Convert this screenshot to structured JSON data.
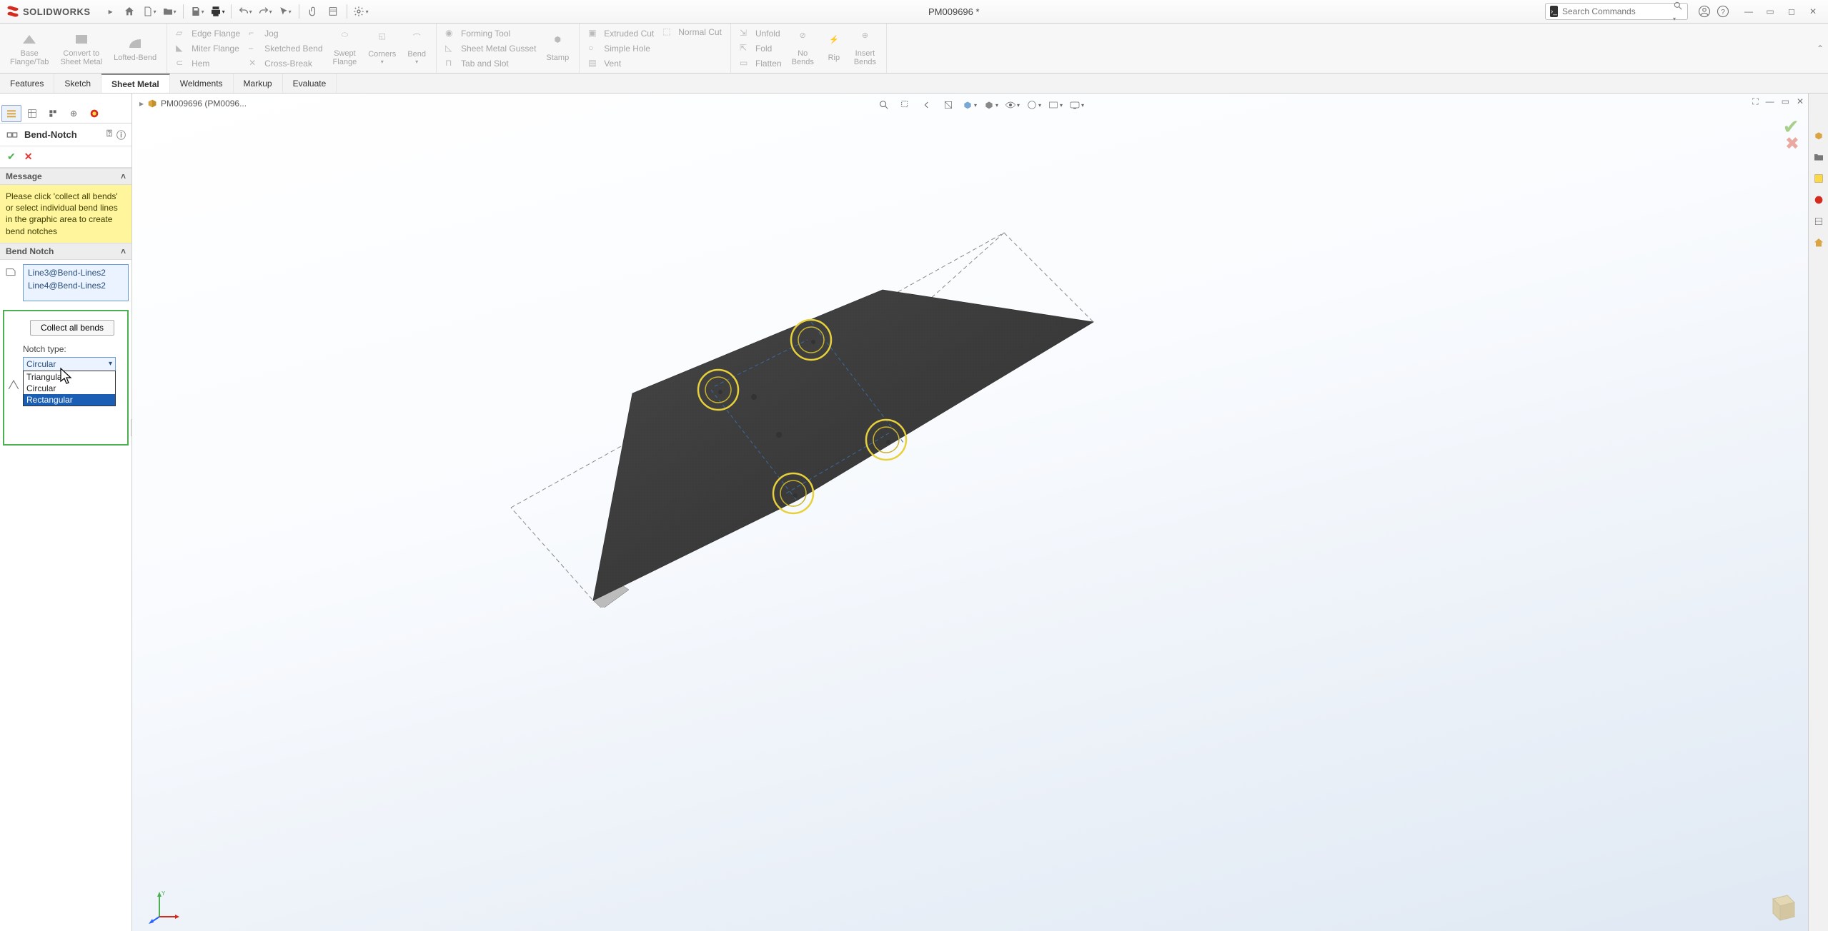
{
  "app": {
    "brand_solid": "SOLID",
    "brand_works": "WORKS",
    "title": "PM009696 *"
  },
  "search": {
    "placeholder": "Search Commands"
  },
  "ribbon": {
    "g1": {
      "base_flange": "Base\nFlange/Tab",
      "convert": "Convert to\nSheet Metal",
      "lofted": "Lofted-Bend"
    },
    "g2": {
      "edge_flange": "Edge Flange",
      "miter_flange": "Miter Flange",
      "hem": "Hem",
      "jog": "Jog",
      "sketched_bend": "Sketched Bend",
      "cross_break": "Cross-Break",
      "swept": "Swept\nFlange",
      "corners": "Corners",
      "bend": "Bend"
    },
    "g3": {
      "forming_tool": "Forming Tool",
      "gusset": "Sheet Metal Gusset",
      "tab_slot": "Tab and Slot",
      "stamp": "Stamp"
    },
    "g4": {
      "extruded_cut": "Extruded Cut",
      "simple_hole": "Simple Hole",
      "vent": "Vent",
      "normal_cut": "Normal Cut"
    },
    "g5": {
      "unfold": "Unfold",
      "fold": "Fold",
      "flatten": "Flatten",
      "no_bends": "No\nBends",
      "rip": "Rip",
      "insert_bends": "Insert\nBends"
    }
  },
  "cmd_tabs": [
    "Features",
    "Sketch",
    "Sheet Metal",
    "Weldments",
    "Markup",
    "Evaluate"
  ],
  "cmd_tab_active": 2,
  "breadcrumb": {
    "part": "PM009696 (PM0096..."
  },
  "pm": {
    "feature": "Bend-Notch",
    "sections": {
      "message": "Message",
      "bend_notch": "Bend Notch"
    },
    "message_body": "Please click 'collect all bends' or select individual bend lines in the graphic area to create bend notches",
    "selections": [
      "Line3@Bend-Lines2",
      "Line4@Bend-Lines2"
    ],
    "collect_btn": "Collect all bends",
    "notch_type_label": "Notch type:",
    "notch_type_value": "Circular",
    "options": [
      "Triangular",
      "Circular",
      "Rectangular"
    ],
    "option_hilite": 2
  }
}
